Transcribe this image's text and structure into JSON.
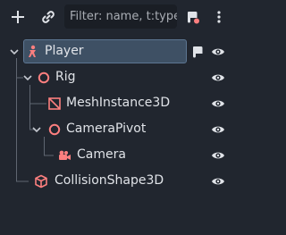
{
  "toolbar": {
    "add_icon": "plus-icon",
    "link_icon": "chain-link-icon",
    "filter_placeholder": "Filter: name, t:type, g:group",
    "filter_value": "",
    "script_icon": "script-icon",
    "menu_icon": "kebab-menu-icon"
  },
  "tree": {
    "nodes": [
      {
        "label": "Player",
        "icon": "character-body-icon",
        "selected": true,
        "has_script": true
      },
      {
        "label": "Rig",
        "icon": "node3d-icon"
      },
      {
        "label": "MeshInstance3D",
        "icon": "mesh-instance-icon"
      },
      {
        "label": "CameraPivot",
        "icon": "node3d-icon"
      },
      {
        "label": "Camera",
        "icon": "camera-icon"
      },
      {
        "label": "CollisionShape3D",
        "icon": "collision-shape-icon"
      }
    ],
    "visibility_icon": "eye-icon",
    "colors": {
      "accent": "#fc7f7f",
      "selection": "#3e5064",
      "guide": "#6b7280"
    }
  }
}
